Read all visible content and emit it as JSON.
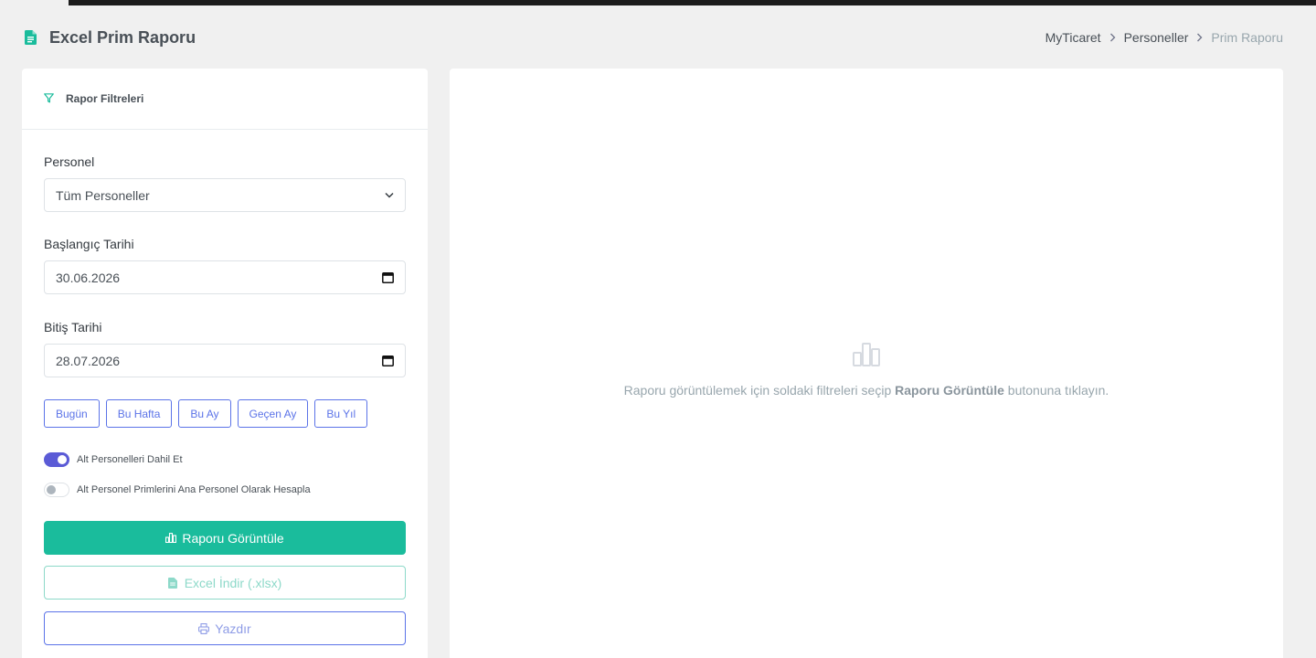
{
  "header": {
    "title": "Excel Prim Raporu",
    "title_icon": "file-excel-icon",
    "breadcrumb": [
      "MyTicaret",
      "Personeller",
      "Prim Raporu"
    ]
  },
  "filters": {
    "title": "Rapor Filtreleri",
    "personel_label": "Personel",
    "personel_value": "Tüm Personeller",
    "start_label": "Başlangıç Tarihi",
    "start_value": "30.06.2026",
    "end_label": "Bitiş Tarihi",
    "end_value": "28.07.2026",
    "quick_ranges": [
      "Bugün",
      "Bu Hafta",
      "Bu Ay",
      "Geçen Ay",
      "Bu Yıl"
    ],
    "switch_include_sub": {
      "label": "Alt Personelleri Dahil Et",
      "on": true
    },
    "switch_sub_as_main": {
      "label": "Alt Personel Primlerini Ana Personel Olarak Hesapla",
      "on": false
    },
    "view_button": "Raporu Görüntüle",
    "excel_button": "Excel İndir (.xlsx)",
    "print_button": "Yazdır"
  },
  "result": {
    "empty_prefix": "Raporu görüntülemek için soldaki filtreleri seçip ",
    "empty_bold": "Raporu Görüntüle",
    "empty_suffix": " butonuna tıklayın."
  },
  "colors": {
    "primary_green": "#1abc9c",
    "accent_blue": "#5b73e8",
    "switch_on": "#5b5bd6",
    "muted": "#98a6ad"
  }
}
